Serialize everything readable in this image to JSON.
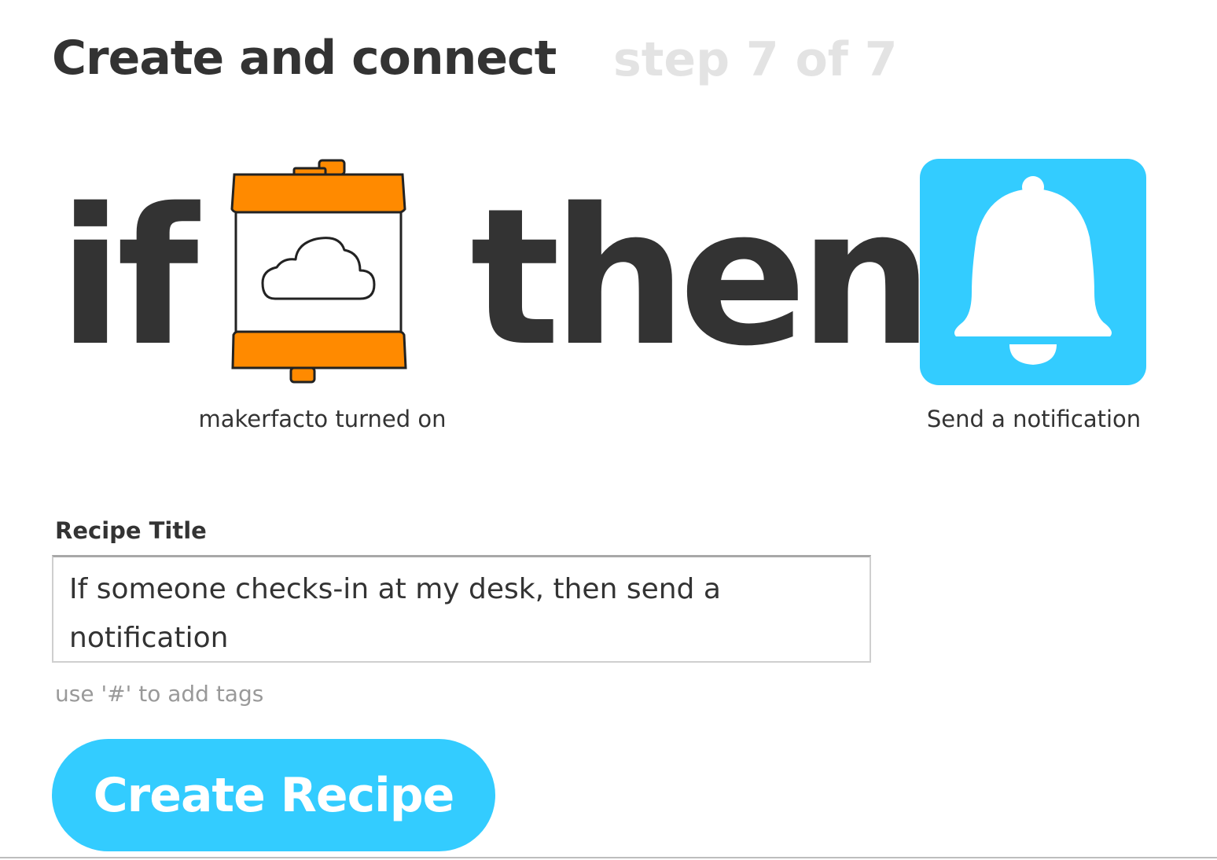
{
  "header": {
    "title": "Create and connect",
    "step": "step 7 of 7"
  },
  "recipe": {
    "if_word": "if",
    "then_word": "then",
    "trigger": {
      "label": "makerfacto turned on",
      "icon": "littlebits-cloud-module-icon",
      "color": "#ff8a00"
    },
    "action": {
      "label": "Send a notification",
      "icon": "bell-icon",
      "color": "#33ccff"
    }
  },
  "form": {
    "title_label": "Recipe Title",
    "title_value": "If someone checks-in at my desk, then send a notification",
    "tag_hint": "use '#' to add tags",
    "submit_label": "Create Recipe"
  },
  "colors": {
    "text": "#333333",
    "step_text": "#e3e3e3",
    "accent": "#33ccff",
    "trigger_orange": "#ff8a00",
    "hint": "#999999"
  }
}
